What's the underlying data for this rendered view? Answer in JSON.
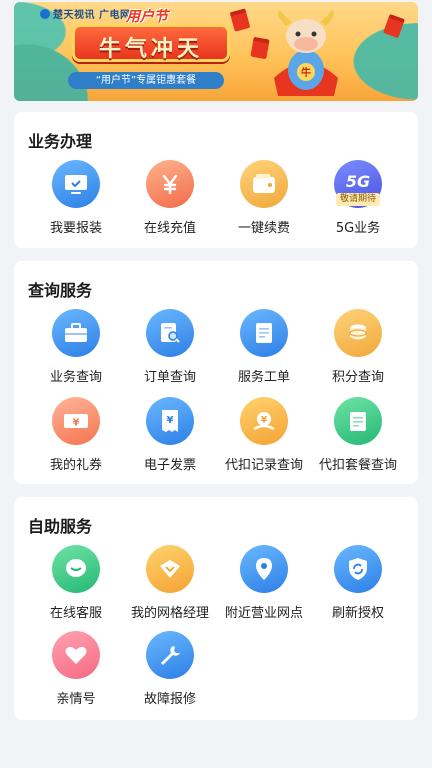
{
  "banner": {
    "brand": "楚天视讯 广电网络",
    "festival": "用户节",
    "headline": "牛气冲天",
    "ox_badge": "牛",
    "ribbon": "“用户节”专属钜惠套餐"
  },
  "sections": [
    {
      "title": "业务办理",
      "items": [
        {
          "label": "我要报装",
          "icon": "tv-icon"
        },
        {
          "label": "在线充值",
          "icon": "yuan-icon"
        },
        {
          "label": "一键续费",
          "icon": "wallet-icon"
        },
        {
          "label": "5G业务",
          "icon": "5g-icon",
          "badge": "敬请期待",
          "icon_text": "5G"
        }
      ]
    },
    {
      "title": "查询服务",
      "items": [
        {
          "label": "业务查询",
          "icon": "briefcase-icon"
        },
        {
          "label": "订单查询",
          "icon": "order-search-icon"
        },
        {
          "label": "服务工单",
          "icon": "document-icon"
        },
        {
          "label": "积分查询",
          "icon": "points-icon"
        },
        {
          "label": "我的礼券",
          "icon": "coupon-icon",
          "icon_text": "¥"
        },
        {
          "label": "电子发票",
          "icon": "invoice-icon",
          "icon_text": "¥"
        },
        {
          "label": "代扣记录查询",
          "icon": "deduct-record-icon",
          "icon_text": "¥"
        },
        {
          "label": "代扣套餐查询",
          "icon": "deduct-package-icon"
        }
      ]
    },
    {
      "title": "自助服务",
      "items": [
        {
          "label": "在线客服",
          "icon": "chat-icon"
        },
        {
          "label": "我的网格经理",
          "icon": "manager-icon"
        },
        {
          "label": "附近营业网点",
          "icon": "location-icon"
        },
        {
          "label": "刷新授权",
          "icon": "refresh-shield-icon"
        },
        {
          "label": "亲情号",
          "icon": "heart-icon"
        },
        {
          "label": "故障报修",
          "icon": "wrench-icon"
        }
      ]
    }
  ]
}
